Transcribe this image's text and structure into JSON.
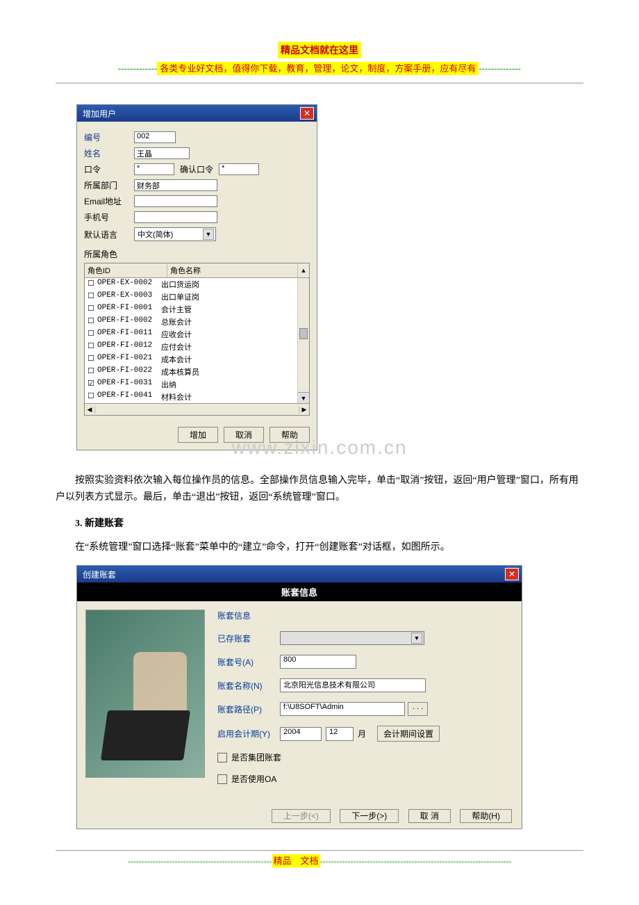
{
  "header": {
    "title": "精品文档就在这里",
    "prefix": "-------------",
    "subtitle_text": "各类专业好文档，值得你下载，教育，管理，论文，制度，方案手册，应有尽有",
    "suffix": "--------------"
  },
  "dlg1": {
    "title": "增加用户",
    "fields": {
      "id_label": "编号",
      "id_value": "002",
      "name_label": "姓名",
      "name_value": "王晶",
      "pwd_label": "口令",
      "pwd_value": "*",
      "confirm_label": "确认口令",
      "confirm_value": "*",
      "dept_label": "所属部门",
      "dept_value": "财务部",
      "email_label": "Email地址",
      "email_value": "",
      "phone_label": "手机号",
      "phone_value": "",
      "lang_label": "默认语言",
      "lang_value": "中文(简体)"
    },
    "roles_header": "所属角色",
    "col1": "角色ID",
    "col2": "角色名称",
    "roles": [
      {
        "id": "OPER-EX-0002",
        "name": "出口货运岗",
        "checked": false
      },
      {
        "id": "OPER-EX-0003",
        "name": "出口单证岗",
        "checked": false
      },
      {
        "id": "OPER-FI-0001",
        "name": "会计主管",
        "checked": false
      },
      {
        "id": "OPER-FI-0002",
        "name": "总账会计",
        "checked": false
      },
      {
        "id": "OPER-FI-0011",
        "name": "应收会计",
        "checked": false
      },
      {
        "id": "OPER-FI-0012",
        "name": "应付会计",
        "checked": false
      },
      {
        "id": "OPER-FI-0021",
        "name": "成本会计",
        "checked": false
      },
      {
        "id": "OPER-FI-0022",
        "name": "成本核算员",
        "checked": false
      },
      {
        "id": "OPER-FI-0031",
        "name": "出纳",
        "checked": true
      },
      {
        "id": "OPER-FI-0041",
        "name": "材料会计",
        "checked": false
      }
    ],
    "btns": {
      "add": "增加",
      "cancel": "取消",
      "help": "帮助"
    }
  },
  "watermark": "www.zixin.com.cn",
  "body_text": {
    "p1": "按照实验资料依次输入每位操作员的信息。全部操作员信息输入完毕，单击“取消”按钮，返回“用户管理”窗口，所有用户以列表方式显示。最后，单击“退出”按钮，返回“系统管理”窗口。",
    "sec_num": "3. 新建账套",
    "p2": "在“系统管理”窗口选择“账套”菜单中的“建立”命令，打开“创建账套”对话框，如图所示。"
  },
  "dlg2": {
    "title": "创建账套",
    "bar": "账套信息",
    "heading": "账套信息",
    "fields": {
      "exist_label": "已存账套",
      "exist_value": "",
      "code_label": "账套号(A)",
      "code_value": "800",
      "name_label": "账套名称(N)",
      "name_value": "北京阳光信息技术有限公司",
      "path_label": "账套路径(P)",
      "path_value": "f:\\U8SOFT\\Admin",
      "dots": ". . .",
      "period_label": "启用会计期(Y)",
      "year": "2004",
      "month": "12",
      "month_unit": "月",
      "period_btn": "会计期间设置",
      "group_label": "是否集团账套",
      "oa_label": "是否使用OA"
    },
    "btns": {
      "prev": "上一步(<)",
      "next": "下一步(>)",
      "cancel": "取 消",
      "help": "帮助(H)"
    }
  },
  "footer": {
    "dash": "----------------------------------------------------",
    "text": "精品　文档",
    "dash2": "---------------------------------------------------------------------"
  }
}
